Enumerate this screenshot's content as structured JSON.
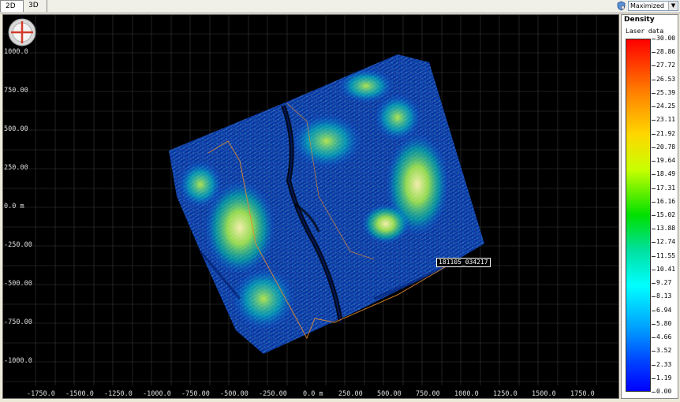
{
  "tabs": [
    {
      "label": "2D",
      "active": true
    },
    {
      "label": "3D",
      "active": false
    }
  ],
  "view_mode": {
    "selected": "Maximized",
    "icon": "shield-icon"
  },
  "plot": {
    "background": "#000000",
    "x_ticks": [
      "-1750.0",
      "-1500.0",
      "-1250.0",
      "-1000.0",
      "-750.00",
      "-500.00",
      "-250.00",
      "0.0 m",
      "250.00",
      "500.00",
      "750.00",
      "1000.0",
      "1250.0",
      "1500.0",
      "1750.0"
    ],
    "y_ticks": [
      "1000.0",
      "750.00",
      "500.00",
      "250.00",
      "0.0 m",
      "-250.00",
      "-500.00",
      "-750.00",
      "-1000.0"
    ],
    "scan_label": "181105_034217",
    "logo_icon": "crosshair-logo-icon"
  },
  "legend": {
    "title": "Density",
    "subtitle": "Laser data",
    "values": [
      "30.00",
      "28.86",
      "27.72",
      "26.53",
      "25.39",
      "24.25",
      "23.11",
      "21.92",
      "20.78",
      "19.64",
      "18.49",
      "17.31",
      "16.16",
      "15.02",
      "13.88",
      "12.74",
      "11.55",
      "10.41",
      "9.27",
      "8.13",
      "6.94",
      "5.80",
      "4.66",
      "3.52",
      "2.33",
      "1.19",
      "0.00"
    ],
    "colors": [
      "#ff0000",
      "#ff8000",
      "#ffd700",
      "#00e000",
      "#00ffff",
      "#0000ff"
    ]
  }
}
